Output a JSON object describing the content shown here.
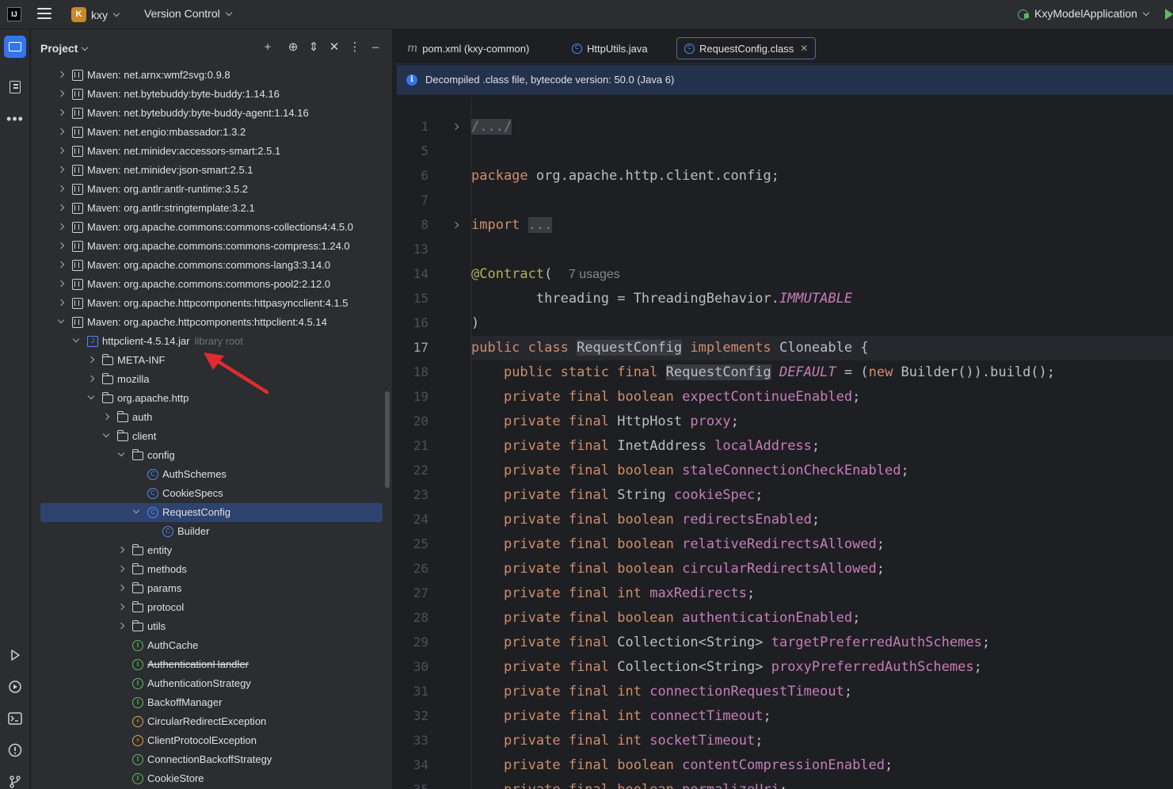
{
  "titlebar": {
    "project_initial": "K",
    "project_name": "kxy",
    "vcs_label": "Version Control",
    "run_config": "KxyModelApplication"
  },
  "project_panel": {
    "title": "Project",
    "tree": [
      {
        "label": "Maven: net.arnx:wmf2svg:0.9.8",
        "icon": "library-icon",
        "level": 0,
        "state": "closed"
      },
      {
        "label": "Maven: net.bytebuddy:byte-buddy:1.14.16",
        "icon": "library-icon",
        "level": 0,
        "state": "closed"
      },
      {
        "label": "Maven: net.bytebuddy:byte-buddy-agent:1.14.16",
        "icon": "library-icon",
        "level": 0,
        "state": "closed"
      },
      {
        "label": "Maven: net.engio:mbassador:1.3.2",
        "icon": "library-icon",
        "level": 0,
        "state": "closed"
      },
      {
        "label": "Maven: net.minidev:accessors-smart:2.5.1",
        "icon": "library-icon",
        "level": 0,
        "state": "closed"
      },
      {
        "label": "Maven: net.minidev:json-smart:2.5.1",
        "icon": "library-icon",
        "level": 0,
        "state": "closed"
      },
      {
        "label": "Maven: org.antlr:antlr-runtime:3.5.2",
        "icon": "library-icon",
        "level": 0,
        "state": "closed"
      },
      {
        "label": "Maven: org.antlr:stringtemplate:3.2.1",
        "icon": "library-icon",
        "level": 0,
        "state": "closed"
      },
      {
        "label": "Maven: org.apache.commons:commons-collections4:4.5.0",
        "icon": "library-icon",
        "level": 0,
        "state": "closed"
      },
      {
        "label": "Maven: org.apache.commons:commons-compress:1.24.0",
        "icon": "library-icon",
        "level": 0,
        "state": "closed"
      },
      {
        "label": "Maven: org.apache.commons:commons-lang3:3.14.0",
        "icon": "library-icon",
        "level": 0,
        "state": "closed"
      },
      {
        "label": "Maven: org.apache.commons:commons-pool2:2.12.0",
        "icon": "library-icon",
        "level": 0,
        "state": "closed"
      },
      {
        "label": "Maven: org.apache.httpcomponents:httpasyncclient:4.1.5",
        "icon": "library-icon",
        "level": 0,
        "state": "closed"
      },
      {
        "label": "Maven: org.apache.httpcomponents:httpclient:4.5.14",
        "icon": "library-icon",
        "level": 0,
        "state": "open"
      },
      {
        "label": "httpclient-4.5.14.jar",
        "hint": "library root",
        "icon": "jar-icon",
        "level": 1,
        "state": "open"
      },
      {
        "label": "META-INF",
        "icon": "folder-icon",
        "level": 2,
        "state": "closed"
      },
      {
        "label": "mozilla",
        "icon": "folder-icon",
        "level": 2,
        "state": "closed"
      },
      {
        "label": "org.apache.http",
        "icon": "folder-icon",
        "level": 2,
        "state": "open"
      },
      {
        "label": "auth",
        "icon": "folder-icon",
        "level": 3,
        "state": "closed"
      },
      {
        "label": "client",
        "icon": "folder-icon",
        "level": 3,
        "state": "open"
      },
      {
        "label": "config",
        "icon": "folder-icon",
        "level": 4,
        "state": "open"
      },
      {
        "label": "AuthSchemes",
        "icon": "class-icon",
        "level": 5,
        "state": "none"
      },
      {
        "label": "CookieSpecs",
        "icon": "class-icon",
        "level": 5,
        "state": "none"
      },
      {
        "label": "RequestConfig",
        "icon": "class-icon",
        "level": 5,
        "state": "open",
        "selected": true
      },
      {
        "label": "Builder",
        "icon": "class-icon",
        "level": 6,
        "state": "none"
      },
      {
        "label": "entity",
        "icon": "folder-icon",
        "level": 4,
        "state": "closed"
      },
      {
        "label": "methods",
        "icon": "folder-icon",
        "level": 4,
        "state": "closed"
      },
      {
        "label": "params",
        "icon": "folder-icon",
        "level": 4,
        "state": "closed"
      },
      {
        "label": "protocol",
        "icon": "folder-icon",
        "level": 4,
        "state": "closed"
      },
      {
        "label": "utils",
        "icon": "folder-icon",
        "level": 4,
        "state": "closed"
      },
      {
        "label": "AuthCache",
        "icon": "interface-icon",
        "level": 4,
        "state": "none"
      },
      {
        "label": "AuthenticationHandler",
        "icon": "interface-icon",
        "level": 4,
        "state": "none",
        "deprecated": true
      },
      {
        "label": "AuthenticationStrategy",
        "icon": "interface-icon",
        "level": 4,
        "state": "none"
      },
      {
        "label": "BackoffManager",
        "icon": "interface-icon",
        "level": 4,
        "state": "none"
      },
      {
        "label": "CircularRedirectException",
        "icon": "exception-icon",
        "level": 4,
        "state": "none"
      },
      {
        "label": "ClientProtocolException",
        "icon": "exception-icon",
        "level": 4,
        "state": "none"
      },
      {
        "label": "ConnectionBackoffStrategy",
        "icon": "interface-icon",
        "level": 4,
        "state": "none"
      },
      {
        "label": "CookieStore",
        "icon": "interface-icon",
        "level": 4,
        "state": "none"
      }
    ]
  },
  "editor": {
    "tabs": [
      {
        "label": "pom.xml (kxy-common)",
        "icon": "maven-icon",
        "active": false
      },
      {
        "label": "HttpUtils.java",
        "icon": "class-icon",
        "active": false
      },
      {
        "label": "RequestConfig.class",
        "icon": "class-icon",
        "active": true
      }
    ],
    "notice": "Decompiled .class file, bytecode version: 50.0 (Java 6)",
    "current_line": "17",
    "lines": [
      {
        "n": "1",
        "fold": true,
        "html": "<span class='fold-box'>/.../</span>"
      },
      {
        "n": "5",
        "html": ""
      },
      {
        "n": "6",
        "html": "<span class='kw'>package</span> org.apache.http.client.config;"
      },
      {
        "n": "7",
        "html": ""
      },
      {
        "n": "8",
        "fold": true,
        "html": "<span class='kw'>import</span> <span class='fold-box'>...</span>"
      },
      {
        "n": "13",
        "html": ""
      },
      {
        "n": "14",
        "html": "<span class='ann'>@Contract</span>(  <span class='usages'>7 usages</span>"
      },
      {
        "n": "15",
        "html": "        threading = ThreadingBehavior.<span class='st'>IMMUTABLE</span>"
      },
      {
        "n": "16",
        "html": ")"
      },
      {
        "n": "17",
        "html": "<span class='kw'>public class</span> <span class='hl'>RequestConfig</span> <span class='kw'>implements</span> Cloneable {"
      },
      {
        "n": "18",
        "html": "    <span class='kw'>public static final</span> <span class='hl'>RequestConfig</span> <span class='st'>DEFAULT</span> = (<span class='kw'>new</span> Builder()).build();"
      },
      {
        "n": "19",
        "html": "    <span class='kw'>private final boolean</span> <span class='fld'>expectContinueEnabled</span>;"
      },
      {
        "n": "20",
        "html": "    <span class='kw'>private final</span> HttpHost <span class='fld'>proxy</span>;"
      },
      {
        "n": "21",
        "html": "    <span class='kw'>private final</span> InetAddress <span class='fld'>localAddress</span>;"
      },
      {
        "n": "22",
        "html": "    <span class='kw'>private final boolean</span> <span class='fld'>staleConnectionCheckEnabled</span>;"
      },
      {
        "n": "23",
        "html": "    <span class='kw'>private final</span> String <span class='fld'>cookieSpec</span>;"
      },
      {
        "n": "24",
        "html": "    <span class='kw'>private final boolean</span> <span class='fld'>redirectsEnabled</span>;"
      },
      {
        "n": "25",
        "html": "    <span class='kw'>private final boolean</span> <span class='fld'>relativeRedirectsAllowed</span>;"
      },
      {
        "n": "26",
        "html": "    <span class='kw'>private final boolean</span> <span class='fld'>circularRedirectsAllowed</span>;"
      },
      {
        "n": "27",
        "html": "    <span class='kw'>private final int</span> <span class='fld'>maxRedirects</span>;"
      },
      {
        "n": "28",
        "html": "    <span class='kw'>private final boolean</span> <span class='fld'>authenticationEnabled</span>;"
      },
      {
        "n": "29",
        "html": "    <span class='kw'>private final</span> Collection&lt;String&gt; <span class='fld'>targetPreferredAuthSchemes</span>;"
      },
      {
        "n": "30",
        "html": "    <span class='kw'>private final</span> Collection&lt;String&gt; <span class='fld'>proxyPreferredAuthSchemes</span>;"
      },
      {
        "n": "31",
        "html": "    <span class='kw'>private final int</span> <span class='fld'>connectionRequestTimeout</span>;"
      },
      {
        "n": "32",
        "html": "    <span class='kw'>private final int</span> <span class='fld'>connectTimeout</span>;"
      },
      {
        "n": "33",
        "html": "    <span class='kw'>private final int</span> <span class='fld'>socketTimeout</span>;"
      },
      {
        "n": "34",
        "html": "    <span class='kw'>private final boolean</span> <span class='fld'>contentCompressionEnabled</span>;"
      },
      {
        "n": "35",
        "html": "    <span class='kw'>private final boolean</span> <span class='fld'>normalizeUri</span>;"
      }
    ]
  },
  "colors": {
    "accent": "#3574f0",
    "selection": "#2e436e",
    "keyword": "#cf8e6d",
    "field": "#c77dbb",
    "annotation": "#b3ae60",
    "annotation_arrow": "#e02c2c"
  }
}
